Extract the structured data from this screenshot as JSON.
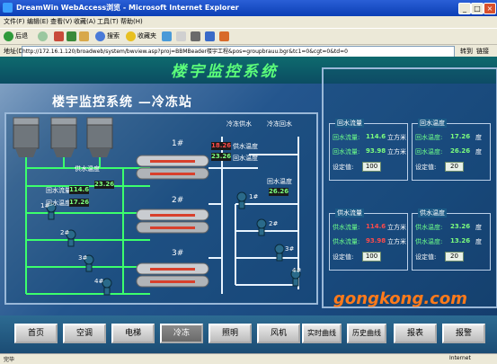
{
  "window": {
    "title": "DreamWin WebAccess浏览 - Microsoft Internet Explorer",
    "minimize": "_",
    "maximize": "□",
    "close": "×"
  },
  "menu": [
    "文件(F)",
    "编辑(E)",
    "查看(V)",
    "收藏(A)",
    "工具(T)",
    "帮助(H)"
  ],
  "toolbar": {
    "back": "后退",
    "forward": "",
    "search": "搜索",
    "favorites": "收藏夹"
  },
  "address": {
    "label": "地址(D)",
    "url": "http://172.16.1.120/broadweb/system/bwview.asp?proj=BBMBeader楼宇工程&pos=groupbrauu.bgr&tc1=0&cgt=0&td=0",
    "go": "转到",
    "links": "链接"
  },
  "scada": {
    "system_title": "楼宇监控系统",
    "page_title": "楼宇监控系统 —冷冻站",
    "top_labels": [
      "冷冻供水",
      "冷冻回水"
    ],
    "chiller_labels": [
      "1#",
      "2#",
      "3#"
    ],
    "left_panel": {
      "supply_temp_label": "供水温度",
      "supply_temp_value": "23.26",
      "return_flow_label": "回水流量",
      "return_flow_value": "114.6",
      "return_temp_label": "回水温度",
      "return_temp_value": "17.26"
    },
    "chiller1": {
      "temp_value": "18.26",
      "temp2_value": "23.26",
      "supply_temp_label": "供水温度",
      "return_temp_label": "回水温度"
    },
    "right_return_temp": {
      "label": "回水温度",
      "value": "26.26"
    },
    "pump_labels_left": [
      "1#",
      "2#",
      "3#",
      "4#"
    ],
    "pump_labels_right": [
      "1#",
      "2#",
      "3#",
      "4#"
    ]
  },
  "groups": [
    {
      "header": "回水流量",
      "rows": [
        {
          "label": "回水流量:",
          "value": "114.6",
          "unit": "立方米"
        },
        {
          "label": "回水流量:",
          "value": "93.98",
          "unit": "立方米"
        }
      ],
      "setpoint_label": "设定值:",
      "setpoint": "100"
    },
    {
      "header": "回水温度",
      "rows": [
        {
          "label": "回水温度:",
          "value": "17.26",
          "unit": "度"
        },
        {
          "label": "回水温度:",
          "value": "26.26",
          "unit": "度"
        }
      ],
      "setpoint_label": "设定值:",
      "setpoint": "20"
    },
    {
      "header": "供水流量",
      "rows": [
        {
          "label": "供水流量:",
          "value": "114.6",
          "unit": "立方米"
        },
        {
          "label": "供水流量:",
          "value": "93.98",
          "unit": "立方米"
        }
      ],
      "setpoint_label": "设定值:",
      "setpoint": "100"
    },
    {
      "header": "供水温度",
      "rows": [
        {
          "label": "供水温度:",
          "value": "23.26",
          "unit": "度"
        },
        {
          "label": "供水温度:",
          "value": "13.26",
          "unit": "度"
        }
      ],
      "setpoint_label": "设定值:",
      "setpoint": "20"
    }
  ],
  "nav": [
    "首页",
    "空调",
    "电梯",
    "冷冻",
    "照明",
    "风机",
    "实时曲线",
    "历史曲线",
    "报表",
    "报警"
  ],
  "nav_active": "冷冻",
  "watermark": "gongkong.com",
  "status": {
    "left": "完毕",
    "zone": "Internet"
  },
  "colors": {
    "value_green": "#7dff7d",
    "value_red": "#ff4a4a",
    "pipe_green": "#3cff6c",
    "pipe_white": "#e8f4ff",
    "title_green": "#5cff7a"
  }
}
